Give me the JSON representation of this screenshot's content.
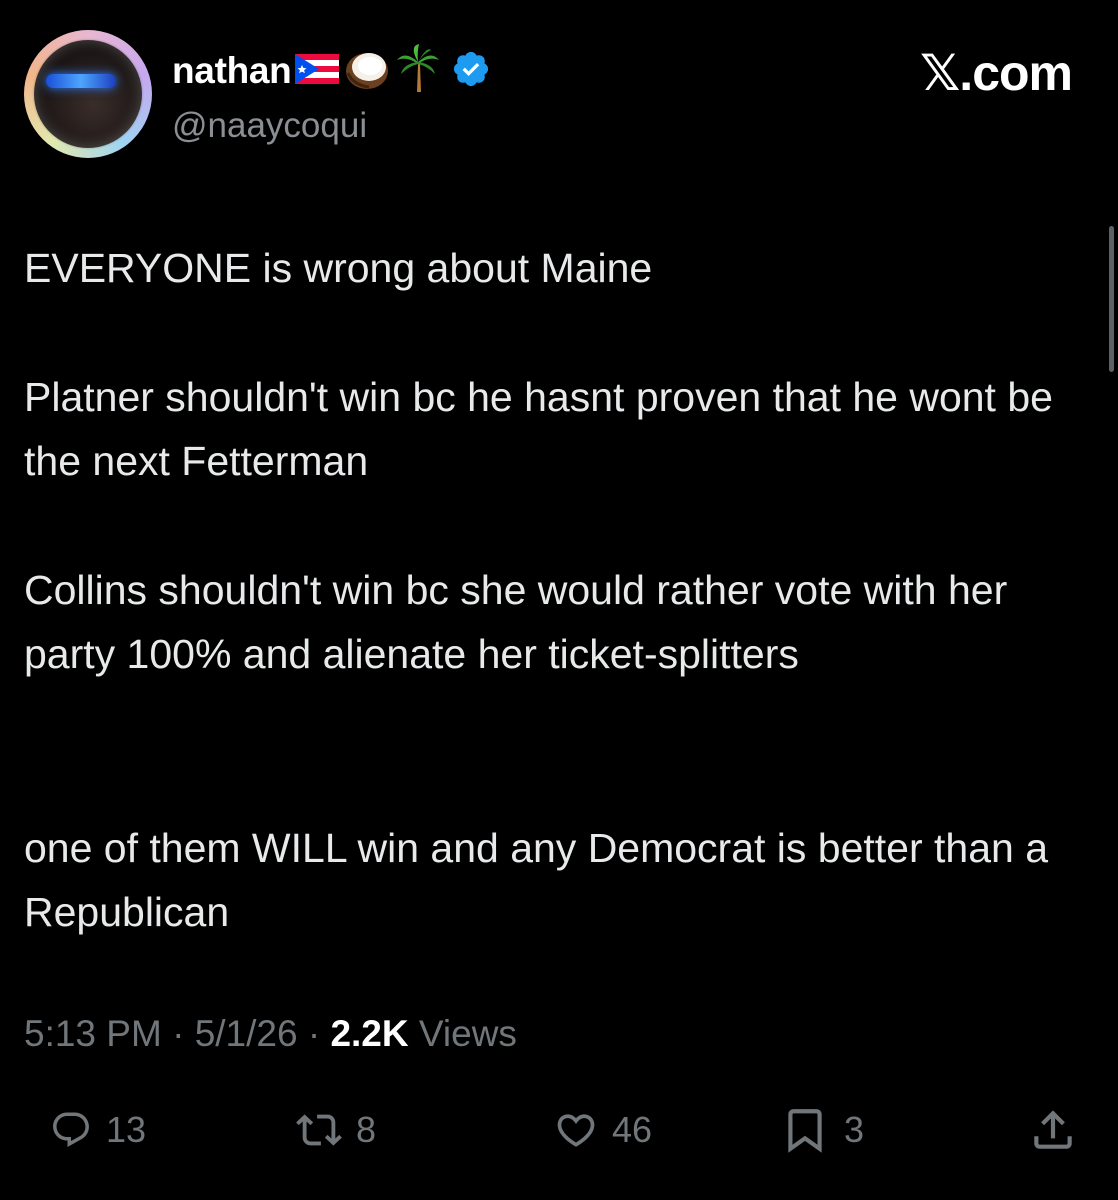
{
  "user": {
    "display_name": "nathan",
    "name_emojis": [
      "🇵🇷",
      "🥥",
      "🌴"
    ],
    "verified": true,
    "handle": "@naaycoqui"
  },
  "brand": "𝕏.com",
  "tweet": {
    "paragraphs": [
      "EVERYONE is wrong about Maine",
      "Platner shouldn't win bc he hasnt proven that he wont be the next Fetterman",
      "Collins shouldn't win bc she would rather vote with her party 100% and alienate her ticket-splitters",
      "one of them WILL win and any Democrat is better than a Republican"
    ]
  },
  "meta": {
    "time": "5:13 PM",
    "separator": " · ",
    "date": "5/1/26",
    "views_count": "2.2K",
    "views_label": " Views"
  },
  "actions": {
    "replies": "13",
    "reposts": "8",
    "likes": "46",
    "bookmarks": "3"
  },
  "colors": {
    "background": "#000000",
    "text": "#e7e9ea",
    "muted": "#71767b",
    "verified_badge": "#1d9bf0"
  },
  "icons": [
    "reply-icon",
    "repost-icon",
    "like-icon",
    "bookmark-icon",
    "share-icon",
    "verified-badge-icon"
  ]
}
